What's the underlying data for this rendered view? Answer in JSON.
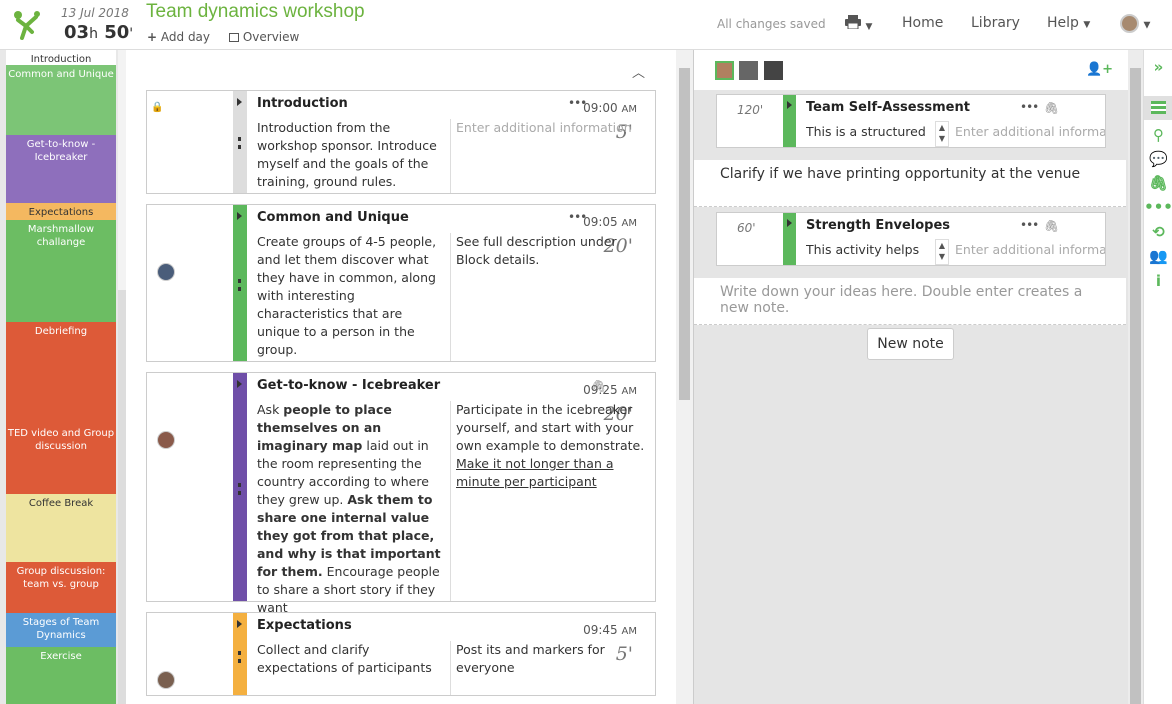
{
  "header": {
    "date": "13 Jul 2018",
    "duration_h": "03",
    "duration_h_unit": "h",
    "duration_m": "50",
    "duration_m_unit": "'",
    "title": "Team dynamics workshop",
    "add_day": "Add day",
    "overview": "Overview",
    "saved": "All changes saved",
    "nav_home": "Home",
    "nav_library": "Library",
    "nav_help": "Help"
  },
  "agenda": [
    {
      "label": "Introduction",
      "color": "#e8e8e8"
    },
    {
      "label": "Common and Unique",
      "color": "#7cc576"
    },
    {
      "label": "Get-to-know - Icebreaker",
      "color": "#8e6fbc"
    },
    {
      "label": "Expectations",
      "color": "#f4b860"
    },
    {
      "label": "Marshmallow challange",
      "color": "#6cbd63"
    },
    {
      "label": "Debriefing",
      "color": "#dd5a38"
    },
    {
      "label": "TED video and Group discussion",
      "color": "#dd5a38"
    },
    {
      "label": "Coffee Break",
      "color": "#eee4a0"
    },
    {
      "label": "Group discussion: team vs. group",
      "color": "#dd5a38"
    },
    {
      "label": "Stages of Team Dynamics",
      "color": "#5b9bd5"
    },
    {
      "label": "Exercise",
      "color": "#6cbd63"
    }
  ],
  "blocks": [
    {
      "time": "09:00",
      "ampm": "AM",
      "duration": "5'",
      "title": "Introduction",
      "color": "#dddddd",
      "description": "Introduction from the workshop sponsor. Introduce myself and the goals of the training, ground rules.",
      "extra": "Enter additional information"
    },
    {
      "time": "09:05",
      "ampm": "AM",
      "duration": "20'",
      "title": "Common and Unique",
      "color": "#5cb85c",
      "description": "Create groups of 4-5 people, and let them discover what they have in common, along with interesting characteristics that are unique to a person in the group.",
      "extra": "See full description under Block details."
    },
    {
      "time": "09:25",
      "ampm": "AM",
      "duration": "20'",
      "title": "Get-to-know - Icebreaker",
      "color": "#6f4fa8",
      "desc_1": "Ask ",
      "desc_2": "people to place themselves on an imaginary map",
      "desc_3": " laid out in the room representing the country according to where they grew up. ",
      "desc_4": "Ask them to share one internal value they got from that place, and why is that important for them.",
      "desc_5": " Encourage people to share a short story if they want",
      "extra_1": "Participate in the icebreaker yourself, and start with your own example to demonstrate. ",
      "extra_2": "Make it not longer than a minute per participant"
    },
    {
      "time": "09:45",
      "ampm": "AM",
      "duration": "5'",
      "title": "Expectations",
      "color": "#f4b040",
      "description": "Collect and clarify expectations of participants",
      "extra": "Post its and markers for everyone"
    }
  ],
  "notes_panel": {
    "cards": [
      {
        "duration": "120'",
        "title": "Team Self-Assessment",
        "description": "This is a structured",
        "extra": "Enter additional information",
        "note": "Clarify if we have printing opportunity at the venue"
      },
      {
        "duration": "60'",
        "title": "Strength Envelopes",
        "description": "This activity helps",
        "extra": "Enter additional information",
        "note": "Write down your ideas here. Double enter creates a new note."
      }
    ],
    "new_note": "New note"
  },
  "icons": {
    "logo": "sessionlab-logo",
    "print": "printer-icon",
    "user": "user-avatar",
    "expand": "double-chevron-right-icon",
    "add_user": "add-user-icon"
  }
}
